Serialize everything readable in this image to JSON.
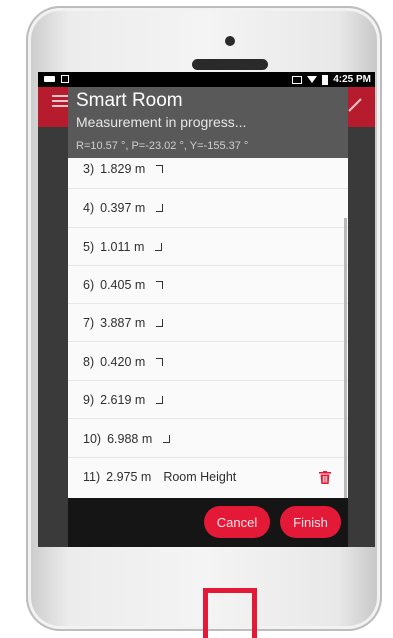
{
  "status_bar": {
    "time": "4:25 PM"
  },
  "dialog": {
    "title": "Smart Room",
    "subtitle": "Measurement in progress...",
    "angles": "R=10.57 °, P=-23.02 °, Y=-155.37 °"
  },
  "measurements": [
    {
      "index": "3)",
      "value": "1.829 m",
      "corner": "down-right",
      "label": ""
    },
    {
      "index": "4)",
      "value": "0.397 m",
      "corner": "up-right",
      "label": ""
    },
    {
      "index": "5)",
      "value": "1.011 m",
      "corner": "up-right",
      "label": ""
    },
    {
      "index": "6)",
      "value": "0.405 m",
      "corner": "down-right",
      "label": ""
    },
    {
      "index": "7)",
      "value": "3.887 m",
      "corner": "up-right",
      "label": ""
    },
    {
      "index": "8)",
      "value": "0.420 m",
      "corner": "down-right",
      "label": ""
    },
    {
      "index": "9)",
      "value": "2.619 m",
      "corner": "up-right",
      "label": ""
    },
    {
      "index": "10)",
      "value": "6.988 m",
      "corner": "up-right",
      "label": ""
    },
    {
      "index": "11)",
      "value": "2.975 m",
      "corner": "",
      "label": "Room Height"
    }
  ],
  "buttons": {
    "cancel": "Cancel",
    "finish": "Finish"
  },
  "icons": {
    "menu": "menu-icon",
    "pencil": "pencil-icon",
    "trash": "trash-icon",
    "wifi": "wifi-icon",
    "battery": "battery-icon"
  },
  "colors": {
    "accent": "#e31937",
    "appbar": "#b71c2e",
    "dialog_header": "#595959",
    "list_bg": "#fafafa",
    "bottom_bar": "#151515"
  }
}
